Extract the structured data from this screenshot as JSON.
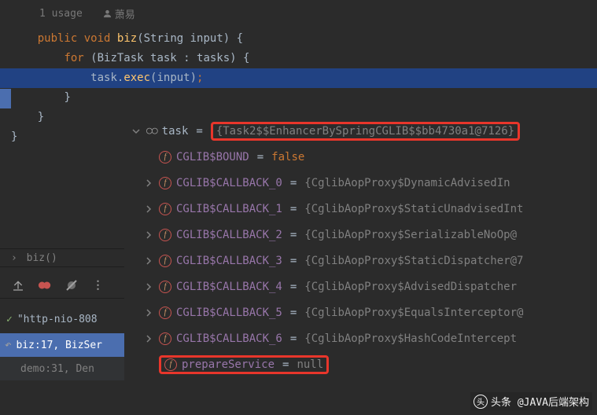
{
  "hints": {
    "usage": "1 usage",
    "author": "萧易"
  },
  "code": {
    "l1_public": "public",
    "l1_void": "void",
    "l1_method": "biz",
    "l1_sig_open": "(String input) {",
    "l2_for": "for",
    "l2_rest": " (BizTask task : tasks) {",
    "l3_expr": "task.",
    "l3_call": "exec",
    "l3_tail_open": "(input)",
    "l3_semi": ";",
    "l4": "}",
    "l5": "}",
    "l6": "}"
  },
  "variables": {
    "root_name": "task",
    "root_value": "{Task2$$EnhancerBySpringCGLIB$$bb4730a1@7126}",
    "rows": [
      {
        "name": "CGLIB$BOUND",
        "value": "false",
        "kw": true,
        "expand": false
      },
      {
        "name": "CGLIB$CALLBACK_0",
        "value": "{CglibAopProxy$DynamicAdvisedIn",
        "kw": false,
        "expand": true
      },
      {
        "name": "CGLIB$CALLBACK_1",
        "value": "{CglibAopProxy$StaticUnadvisedInt",
        "kw": false,
        "expand": true
      },
      {
        "name": "CGLIB$CALLBACK_2",
        "value": "{CglibAopProxy$SerializableNoOp@",
        "kw": false,
        "expand": true
      },
      {
        "name": "CGLIB$CALLBACK_3",
        "value": "{CglibAopProxy$StaticDispatcher@7",
        "kw": false,
        "expand": true
      },
      {
        "name": "CGLIB$CALLBACK_4",
        "value": "{CglibAopProxy$AdvisedDispatcher",
        "kw": false,
        "expand": true
      },
      {
        "name": "CGLIB$CALLBACK_5",
        "value": "{CglibAopProxy$EqualsInterceptor@",
        "kw": false,
        "expand": true
      },
      {
        "name": "CGLIB$CALLBACK_6",
        "value": "{CglibAopProxy$HashCodeIntercept",
        "kw": false,
        "expand": true
      }
    ],
    "boxed_row": {
      "name": "prepareService",
      "value": "null"
    }
  },
  "breadcrumb": {
    "method": "biz()"
  },
  "thread": {
    "name": "\"http-nio-808"
  },
  "frames": {
    "active": "biz:17, BizSer",
    "next": "demo:31, Den"
  },
  "watermark": "头条 @JAVA后端架构"
}
